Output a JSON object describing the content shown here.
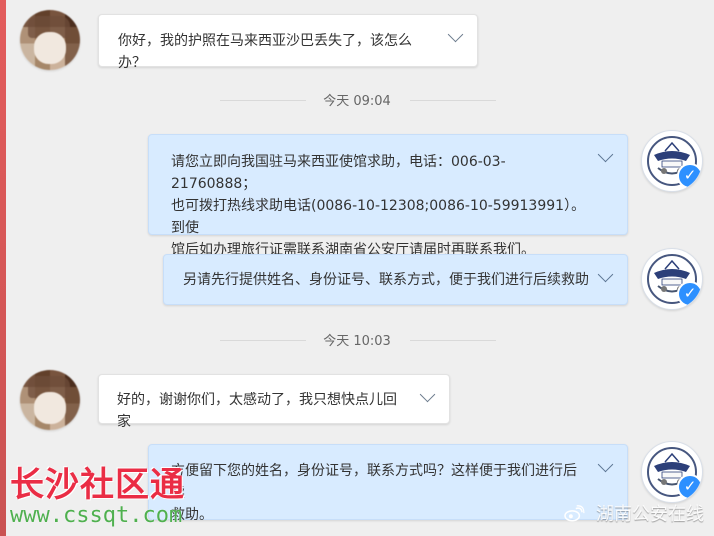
{
  "chat": {
    "time_dividers": [
      {
        "label": "今天 09:04"
      },
      {
        "label": "今天 10:03"
      }
    ],
    "messages": [
      {
        "sender": "user",
        "text": "你好，我的护照在马来西亚沙巴丢失了，该怎么办？"
      },
      {
        "sender": "police",
        "text": "请您立即向我国驻马来西亚使馆求助，电话：006-03-21760888；\n也可拨打热线求助电话(0086-10-12308;0086-10-59913991）。到使\n馆后如办理旅行证需联系湖南省公安厅请届时再联系我们。"
      },
      {
        "sender": "police",
        "text": "另请先行提供姓名、身份证号、联系方式，便于我们进行后续救助"
      },
      {
        "sender": "user",
        "text": "好的，谢谢你们，太感动了，我只想快点儿回家"
      },
      {
        "sender": "police",
        "text": "方便留下您的姓名，身份证号，联系方式吗？这样便于我们进行后续\n救助。"
      }
    ]
  },
  "watermarks": {
    "left_title": "长沙社区通",
    "left_site": "www.cssqt.com",
    "right_account": "湖南公安在线"
  },
  "icons": {
    "message_menu": "chevron-down-icon",
    "verified": "verified-badge-icon",
    "weibo": "weibo-icon"
  },
  "colors": {
    "incoming_bubble": "#ffffff",
    "outgoing_bubble": "#d8ebff",
    "verified_badge": "#2d90ff",
    "watermark_red": "#ea2d45",
    "watermark_green": "#4fb04f"
  }
}
